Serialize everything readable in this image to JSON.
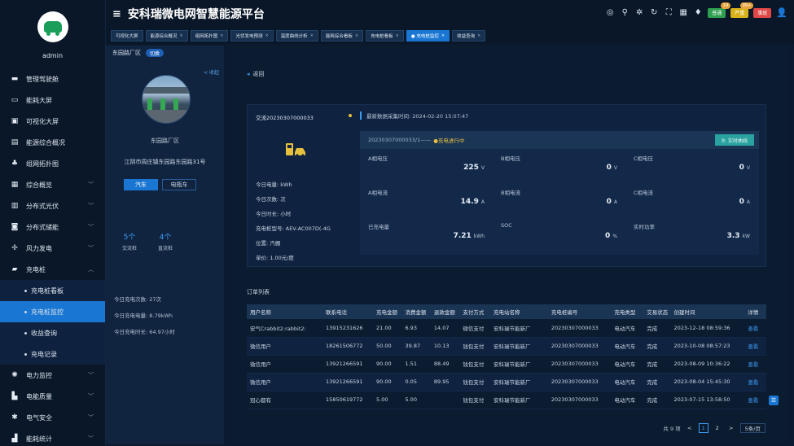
{
  "header": {
    "title": "安科瑞微电网智慧能源平台",
    "badges": [
      {
        "label": "普通",
        "count": "14",
        "color": "#2e9e4f"
      },
      {
        "label": "严重",
        "count": "99+",
        "color": "#d9b21a"
      },
      {
        "label": "事故",
        "count": "",
        "color": "#e04848"
      }
    ]
  },
  "tabs": [
    {
      "label": "可视化大屏",
      "closable": false
    },
    {
      "label": "能源综合概况",
      "closable": true
    },
    {
      "label": "组网拓扑图",
      "closable": true
    },
    {
      "label": "光伏发电预测",
      "closable": true
    },
    {
      "label": "温度曲线分析",
      "closable": true
    },
    {
      "label": "能耗综合看板",
      "closable": true
    },
    {
      "label": "充电桩看板",
      "closable": true
    },
    {
      "label": "● 充电桩监控",
      "closable": true,
      "active": true
    },
    {
      "label": "收益查询",
      "closable": true
    }
  ],
  "sidebar": {
    "user": "admin",
    "items": [
      {
        "label": "管理驾驶舱",
        "icon": "▬"
      },
      {
        "label": "能耗大屏",
        "icon": "▭"
      },
      {
        "label": "可视化大屏",
        "icon": "▣"
      },
      {
        "label": "能源综合概况",
        "icon": "▤"
      },
      {
        "label": "组网拓扑图",
        "icon": "♣"
      },
      {
        "label": "综合概览",
        "icon": "▦",
        "chev": "﹀"
      },
      {
        "label": "分布式光伏",
        "icon": "▥",
        "chev": "﹀"
      },
      {
        "label": "分布式储能",
        "icon": "◙",
        "chev": "﹀"
      },
      {
        "label": "风力发电",
        "icon": "✢",
        "chev": "﹀"
      },
      {
        "label": "充电桩",
        "icon": "▰",
        "chev": "︿"
      },
      {
        "label": "充电桩看板",
        "sub": true
      },
      {
        "label": "充电桩监控",
        "sub": true,
        "active": true
      },
      {
        "label": "收益查询",
        "sub": true
      },
      {
        "label": "充电记录",
        "sub": true
      },
      {
        "label": "电力监控",
        "icon": "✺",
        "chev": "﹀"
      },
      {
        "label": "电能质量",
        "icon": "▙",
        "chev": "﹀"
      },
      {
        "label": "电气安全",
        "icon": "✱",
        "chev": "﹀"
      },
      {
        "label": "能耗统计",
        "icon": "▟",
        "chev": "﹀"
      }
    ]
  },
  "station": {
    "region": "东园路厂区",
    "switch_label": "切换",
    "collapse_label": "< 收起",
    "name": "东园路厂区",
    "address": "江阴市周庄镇东园路东园路31号",
    "type_car": "汽车",
    "type_ebike": "电瓶车",
    "fast_count": "5个",
    "fast_label": "交流桩",
    "slow_count": "4个",
    "slow_label": "直流桩",
    "stat_times": "今日充电次数: 27次",
    "stat_kwh": "今日充电电量: 8.79kWh",
    "stat_duration": "今日充电时长: 64.97小时"
  },
  "main": {
    "back_label": "返回",
    "pile": {
      "code": "交流20230307000033",
      "today_energy": "今日电量:  kWh",
      "today_times": "今日次数:  次",
      "today_duration": "今日时长:  小时",
      "model": "充电桩型号: AEV-AC007D(-4G",
      "location": "位置: 汽棚",
      "price": "单价: 1.00元/度"
    },
    "collect_time": "最新数据采集时间: 2024-02-20 15:07:47",
    "gun": "20230307000033/1——",
    "gun_state": "●充电进行中",
    "curve_btn": "实时曲线",
    "metrics": [
      {
        "label": "A相电压",
        "value": "225",
        "unit": "V"
      },
      {
        "label": "B相电压",
        "value": "0",
        "unit": "V"
      },
      {
        "label": "C相电压",
        "value": "0",
        "unit": "V"
      },
      {
        "label": "A相电流",
        "value": "14.9",
        "unit": "A"
      },
      {
        "label": "B相电流",
        "value": "0",
        "unit": "A"
      },
      {
        "label": "C相电流",
        "value": "0",
        "unit": "A"
      },
      {
        "label": "已充电量",
        "value": "7.21",
        "unit": "kWh"
      },
      {
        "label": "SOC",
        "value": "0",
        "unit": "%"
      },
      {
        "label": "实时功率",
        "value": "3.3",
        "unit": "kW"
      }
    ],
    "orders_title": "订单列表",
    "columns": [
      "用户名称",
      "联系电话",
      "充电金额",
      "消费金额",
      "退款金额",
      "支付方式",
      "充电站名称",
      "充电桩编号",
      "充电类型",
      "交易状态",
      "创建时间",
      "详情"
    ],
    "rows": [
      [
        "安气Crabbit2:rabbit2:",
        "13915231626",
        "21.00",
        "6.93",
        "14.07",
        "微信支付",
        "安科瑞节能新厂",
        "20230307000033",
        "电动汽车",
        "完成",
        "2023-12-18 08:59:36",
        "查看"
      ],
      [
        "微信用户",
        "18261506772",
        "50.00",
        "39.87",
        "10.13",
        "钱包支付",
        "安科瑞节能新厂",
        "20230307000033",
        "电动汽车",
        "完成",
        "2023-10-08 08:57:23",
        "查看"
      ],
      [
        "微信用户",
        "13921266591",
        "90.00",
        "1.51",
        "88.49",
        "钱包支付",
        "安科瑞节能新厂",
        "20230307000033",
        "电动汽车",
        "完成",
        "2023-08-09 10:36:22",
        "查看"
      ],
      [
        "微信用户",
        "13921266591",
        "90.00",
        "0.05",
        "89.95",
        "钱包支付",
        "安科瑞节能新厂",
        "20230307000033",
        "电动汽车",
        "完成",
        "2023-08-04 15:45:30",
        "查看"
      ],
      [
        "冠心都有",
        "15850619772",
        "5.00",
        "5.00",
        "",
        "钱包支付",
        "安科瑞节能新厂",
        "20230307000033",
        "电动汽车",
        "完成",
        "2023-07-15 13:58:50",
        "查看"
      ]
    ],
    "pager": {
      "total": "共 9 项",
      "prev": "<",
      "p1": "1",
      "p2": "2",
      "next": ">",
      "size": "5条/页"
    }
  }
}
